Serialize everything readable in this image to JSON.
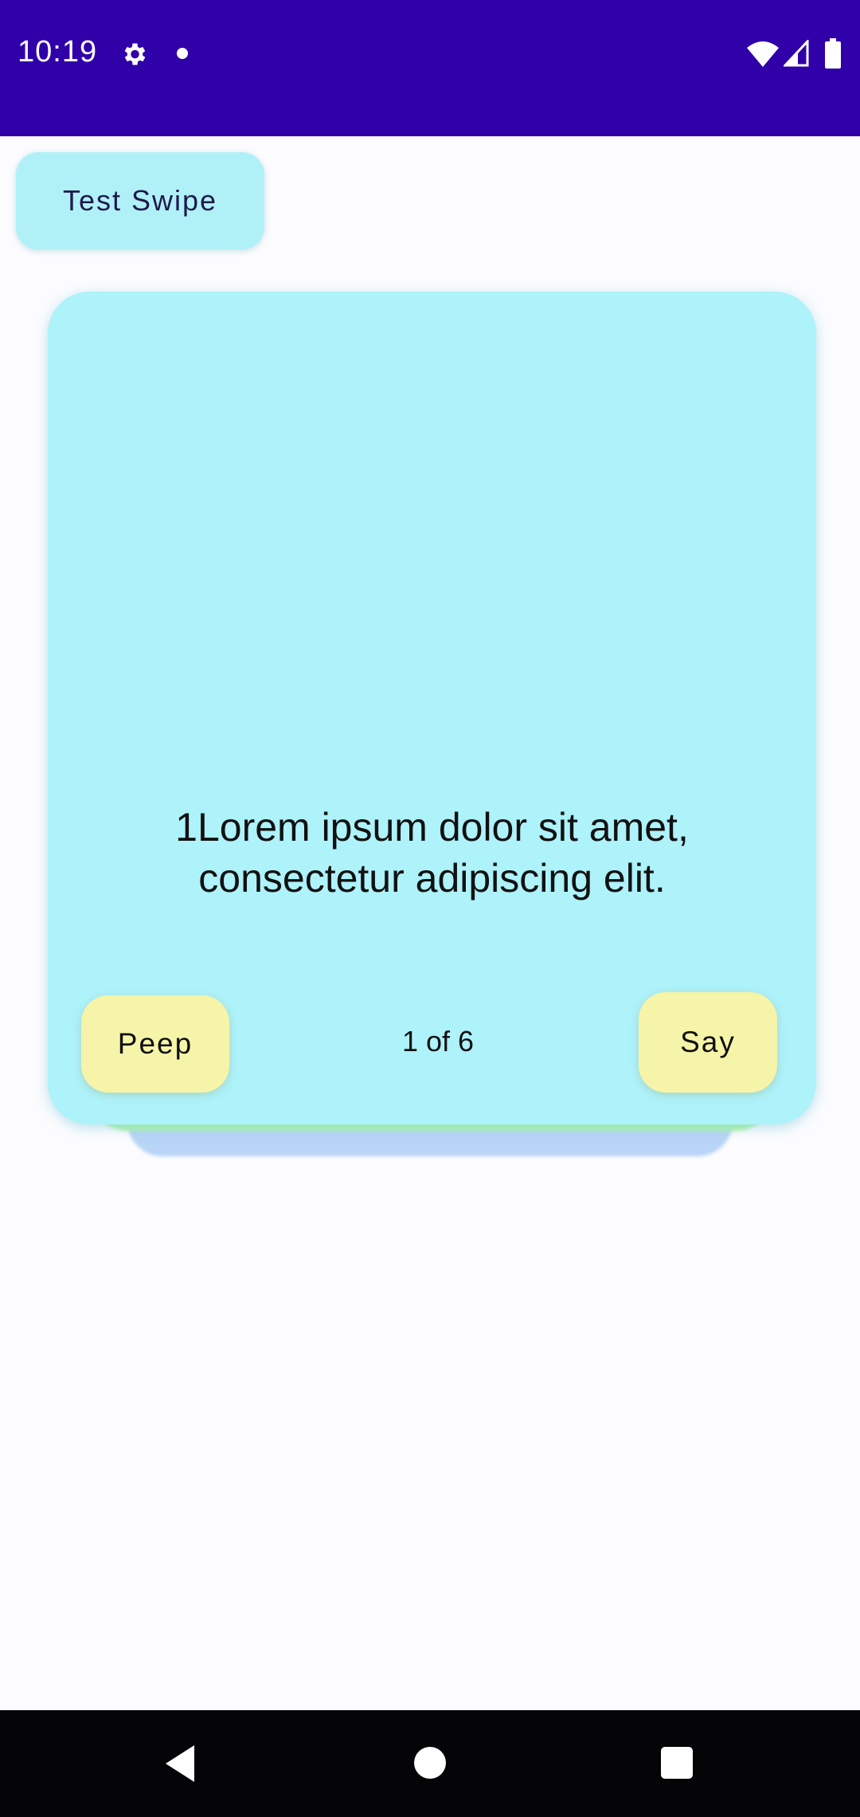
{
  "status_bar": {
    "time": "10:19",
    "icons": [
      "settings-gear-icon",
      "notification-dot-icon",
      "wifi-icon",
      "signal-icon",
      "battery-icon"
    ],
    "background_color": "#3000a8"
  },
  "header": {
    "test_swipe_label": "Test Swipe"
  },
  "card": {
    "text": "1Lorem ipsum dolor sit amet, consectetur adipiscing elit.",
    "peep_label": "Peep",
    "say_label": "Say",
    "counter": "1 of 6",
    "card_color": "#aef2fa",
    "button_color": "#f6f4a8",
    "stack_colors": [
      "#b2f5a8",
      "#b8d4f6"
    ]
  },
  "nav_bar": {
    "buttons": [
      "back-icon",
      "home-icon",
      "recents-icon"
    ]
  }
}
